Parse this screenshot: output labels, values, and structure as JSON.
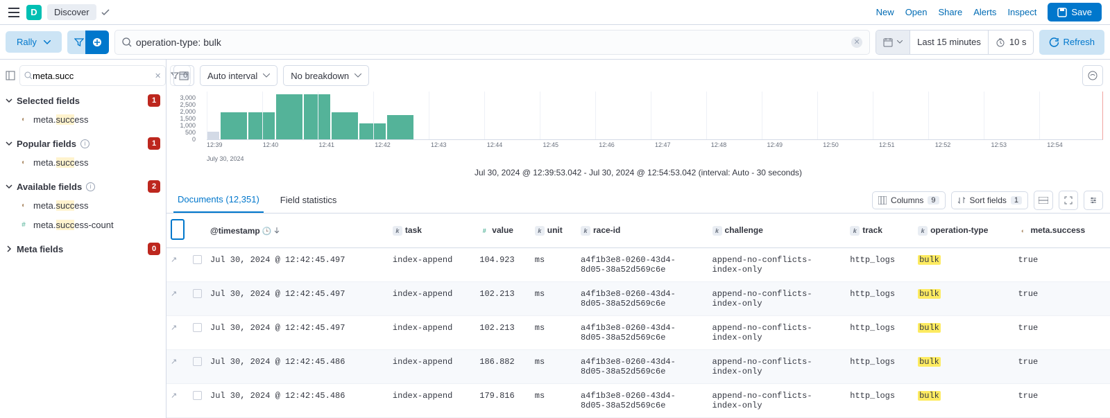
{
  "header": {
    "app_initial": "D",
    "breadcrumb": "Discover",
    "links": {
      "new": "New",
      "open": "Open",
      "share": "Share",
      "alerts": "Alerts",
      "inspect": "Inspect"
    },
    "save": "Save"
  },
  "querybar": {
    "dataview": "Rally",
    "search_value": "operation-type: bulk",
    "time_label": "Last 15 minutes",
    "interval": "10 s",
    "refresh": "Refresh"
  },
  "sidebar": {
    "collapse_icon": "sidebar-collapse",
    "field_search": "meta.succ",
    "filter_count": "0",
    "sections": {
      "selected": {
        "label": "Selected fields",
        "count": "1"
      },
      "popular": {
        "label": "Popular fields",
        "count": "1"
      },
      "available": {
        "label": "Available fields",
        "count": "2"
      },
      "meta": {
        "label": "Meta fields",
        "count": "0"
      }
    },
    "fields": {
      "meta_success_pre": "meta.",
      "meta_success_match": "succ",
      "meta_success_post": "ess",
      "meta_success_count_pre": "meta.",
      "meta_success_count_match": "succ",
      "meta_success_count_post": "ess-count"
    }
  },
  "histogram": {
    "interval_btn": "Auto interval",
    "breakdown_btn": "No breakdown",
    "y_ticks": [
      "3,000",
      "2,500",
      "2,000",
      "1,500",
      "1,000",
      "500",
      "0"
    ],
    "x_ticks": [
      "12:39",
      "12:40",
      "12:41",
      "",
      "12:42",
      "",
      "12:43",
      "",
      "12:44",
      "",
      "12:45",
      "",
      "12:46",
      "",
      "12:47",
      "",
      "12:48",
      "",
      "12:49",
      "",
      "12:50",
      "",
      "12:51",
      "",
      "12:52",
      "",
      "12:53",
      "",
      "12:54"
    ],
    "x_date": "July 30, 2024",
    "caption": "Jul 30, 2024 @ 12:39:53.042 - Jul 30, 2024 @ 12:54:53.042 (interval: Auto - 30 seconds)",
    "chart_data": {
      "type": "bar",
      "x_start": "12:39",
      "x_end": "12:55",
      "interval_seconds": 30,
      "ylim": [
        0,
        3000
      ],
      "title": "",
      "xlabel": "",
      "ylabel": "",
      "bars": [
        {
          "bucket_start": "12:39:30",
          "value": 500,
          "partial": true
        },
        {
          "bucket_start": "12:40:00",
          "value": 1700,
          "partial": false
        },
        {
          "bucket_start": "12:40:30",
          "value": 1700,
          "partial": false
        },
        {
          "bucket_start": "12:41:00",
          "value": 2850,
          "partial": false
        },
        {
          "bucket_start": "12:41:30",
          "value": 2850,
          "partial": false
        },
        {
          "bucket_start": "12:42:00",
          "value": 1700,
          "partial": false
        },
        {
          "bucket_start": "12:42:30",
          "value": 1000,
          "partial": false
        },
        {
          "bucket_start": "12:43:00",
          "value": 1550,
          "partial": false
        },
        {
          "bucket_start": "12:43:30",
          "value": 0,
          "partial": false
        }
      ]
    }
  },
  "tabs": {
    "documents": "Documents (12,351)",
    "field_stats": "Field statistics",
    "columns": "Columns",
    "columns_n": "9",
    "sort": "Sort fields",
    "sort_n": "1"
  },
  "table": {
    "columns": {
      "timestamp": "@timestamp",
      "task": "task",
      "value": "value",
      "unit": "unit",
      "race_id": "race-id",
      "challenge": "challenge",
      "track": "track",
      "operation_type": "operation-type",
      "meta_success": "meta.success"
    },
    "rows": [
      {
        "ts": "Jul 30, 2024 @ 12:42:45.497",
        "task": "index-append",
        "value": "104.923",
        "unit": "ms",
        "race": "a4f1b3e8-0260-43d4-8d05-38a52d569c6e",
        "challenge": "append-no-conflicts-index-only",
        "track": "http_logs",
        "op": "bulk",
        "succ": "true"
      },
      {
        "ts": "Jul 30, 2024 @ 12:42:45.497",
        "task": "index-append",
        "value": "102.213",
        "unit": "ms",
        "race": "a4f1b3e8-0260-43d4-8d05-38a52d569c6e",
        "challenge": "append-no-conflicts-index-only",
        "track": "http_logs",
        "op": "bulk",
        "succ": "true"
      },
      {
        "ts": "Jul 30, 2024 @ 12:42:45.497",
        "task": "index-append",
        "value": "102.213",
        "unit": "ms",
        "race": "a4f1b3e8-0260-43d4-8d05-38a52d569c6e",
        "challenge": "append-no-conflicts-index-only",
        "track": "http_logs",
        "op": "bulk",
        "succ": "true"
      },
      {
        "ts": "Jul 30, 2024 @ 12:42:45.486",
        "task": "index-append",
        "value": "186.882",
        "unit": "ms",
        "race": "a4f1b3e8-0260-43d4-8d05-38a52d569c6e",
        "challenge": "append-no-conflicts-index-only",
        "track": "http_logs",
        "op": "bulk",
        "succ": "true"
      },
      {
        "ts": "Jul 30, 2024 @ 12:42:45.486",
        "task": "index-append",
        "value": "179.816",
        "unit": "ms",
        "race": "a4f1b3e8-0260-43d4-8d05-38a52d569c6e",
        "challenge": "append-no-conflicts-index-only",
        "track": "http_logs",
        "op": "bulk",
        "succ": "true"
      }
    ]
  }
}
